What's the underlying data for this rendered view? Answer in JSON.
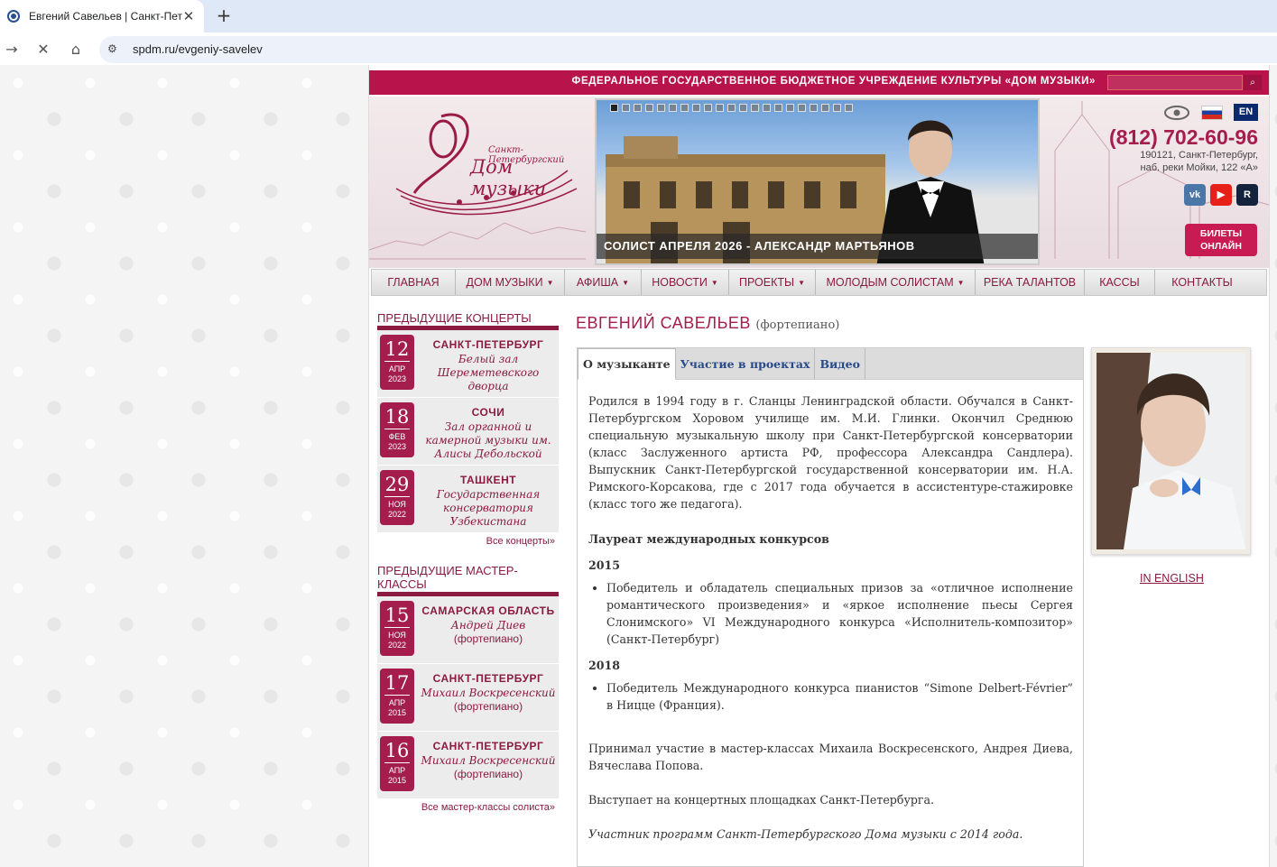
{
  "browser": {
    "tab_title": "Евгений Савельев | Санкт-Петербургский Дом музыки",
    "tab_close": "✕",
    "new_tab": "+",
    "url": "spdm.ru/evgeniy-savelev"
  },
  "site": {
    "top_strip_text": "ФЕДЕРАЛЬНОЕ ГОСУДАРСТВЕННОЕ БЮДЖЕТНОЕ УЧРЕЖДЕНИЕ КУЛЬТУРЫ «ДОМ МУЗЫКИ»",
    "search_placeholder": "",
    "logo_sub": "Санкт-Петербургский",
    "logo_main": "Дом музыки",
    "banner_caption": "СОЛИСТ АПРЕЛЯ 2026 - АЛЕКСАНДР МАРТЬЯНОВ",
    "banner_dot_count": 21,
    "lang_en": "EN",
    "phone": "(812) 702-60-96",
    "address_line1": "190121, Санкт-Петербург,",
    "address_line2": "наб. реки Мойки, 122 «А»",
    "social": {
      "vk": "vk",
      "youtube": "▶",
      "rutube": "R"
    },
    "tickets_line1": "БИЛЕТЫ",
    "tickets_line2": "ОНЛАЙН",
    "accent_color": "#b8134a"
  },
  "nav": [
    {
      "label": "ГЛАВНАЯ",
      "caret": false
    },
    {
      "label": "ДОМ МУЗЫКИ",
      "caret": true
    },
    {
      "label": "АФИША",
      "caret": true
    },
    {
      "label": "НОВОСТИ",
      "caret": true
    },
    {
      "label": "ПРОЕКТЫ",
      "caret": true
    },
    {
      "label": "МОЛОДЫМ СОЛИСТАМ",
      "caret": true
    },
    {
      "label": "РЕКА ТАЛАНТОВ",
      "caret": false
    },
    {
      "label": "КАССЫ",
      "caret": false
    },
    {
      "label": "КОНТАКТЫ",
      "caret": false
    }
  ],
  "sidebar": {
    "concerts_heading": "ПРЕДЫДУЩИЕ КОНЦЕРТЫ",
    "concerts": [
      {
        "day": "12",
        "month": "АПР",
        "year": "2023",
        "city": "САНКТ-ПЕТЕРБУРГ",
        "venue": "Белый зал Шереметевского дворца",
        "sub": ""
      },
      {
        "day": "18",
        "month": "ФЕВ",
        "year": "2023",
        "city": "СОЧИ",
        "venue": "Зал органной и камерной музыки им. Алисы Дебольской",
        "sub": ""
      },
      {
        "day": "29",
        "month": "НОЯ",
        "year": "2022",
        "city": "ТАШКЕНТ",
        "venue": "Государственная консерватория Узбекистана",
        "sub": ""
      }
    ],
    "concerts_more": "Все концерты»",
    "masterclasses_heading": "ПРЕДЫДУЩИЕ МАСТЕР-КЛАССЫ",
    "masterclasses": [
      {
        "day": "15",
        "month": "НОЯ",
        "year": "2022",
        "city": "САМАРСКАЯ ОБЛАСТЬ",
        "venue": "Андрей Диев",
        "sub": "(фортепиано)"
      },
      {
        "day": "17",
        "month": "АПР",
        "year": "2015",
        "city": "САНКТ-ПЕТЕРБУРГ",
        "venue": "Михаил Воскресенский",
        "sub": "(фортепиано)"
      },
      {
        "day": "16",
        "month": "АПР",
        "year": "2015",
        "city": "САНКТ-ПЕТЕРБУРГ",
        "venue": "Михаил Воскресенский",
        "sub": "(фортепиано)"
      }
    ],
    "masterclasses_more": "Все мастер-классы солиста»"
  },
  "main": {
    "title": "ЕВГЕНИЙ САВЕЛЬЕВ",
    "title_sub": "(фортепиано)",
    "tabs": [
      {
        "label": "О музыканте",
        "active": true
      },
      {
        "label": "Участие в проектах",
        "active": false
      },
      {
        "label": "Видео",
        "active": false
      }
    ],
    "bio": "Родился в 1994 году в г. Сланцы Ленинградской области. Обучался в Санкт-Петербургском Хоровом училище им. М.И. Глинки. Окончил Среднюю специальную музыкальную школу при Санкт-Петербургской консерватории (класс Заслуженного артиста РФ, профессора Александра Сандлера). Выпускник Санкт-Петербургской государственной консерватории им. Н.А. Римского-Корсакова, где с 2017 года обучается в ассистентуре-стажировке (класс того же педагога).",
    "laureate_heading": "Лауреат международных конкурсов",
    "year1": "2015",
    "item1": "Победитель и обладатель специальных призов за «отличное исполнение романтического произведения» и «яркое исполнение пьесы Сергея Слонимского» VI Международного конкурса «Исполнитель-композитор» (Санкт-Петербург)",
    "year2": "2018",
    "item2": "Победитель Международного конкурса пианистов “Simone Delbert-Février” в Ницце (Франция).",
    "para_masterclasses": "Принимал участие в мастер-классах Михаила Воскресенского, Андрея Диева, Вячеслава Попова.",
    "para_venues": "Выступает на концертных площадках Санкт-Петербурга.",
    "para_program": "Участник программ Санкт-Петербургского Дома музыки с 2014 года.",
    "in_english": "IN ENGLISH"
  }
}
